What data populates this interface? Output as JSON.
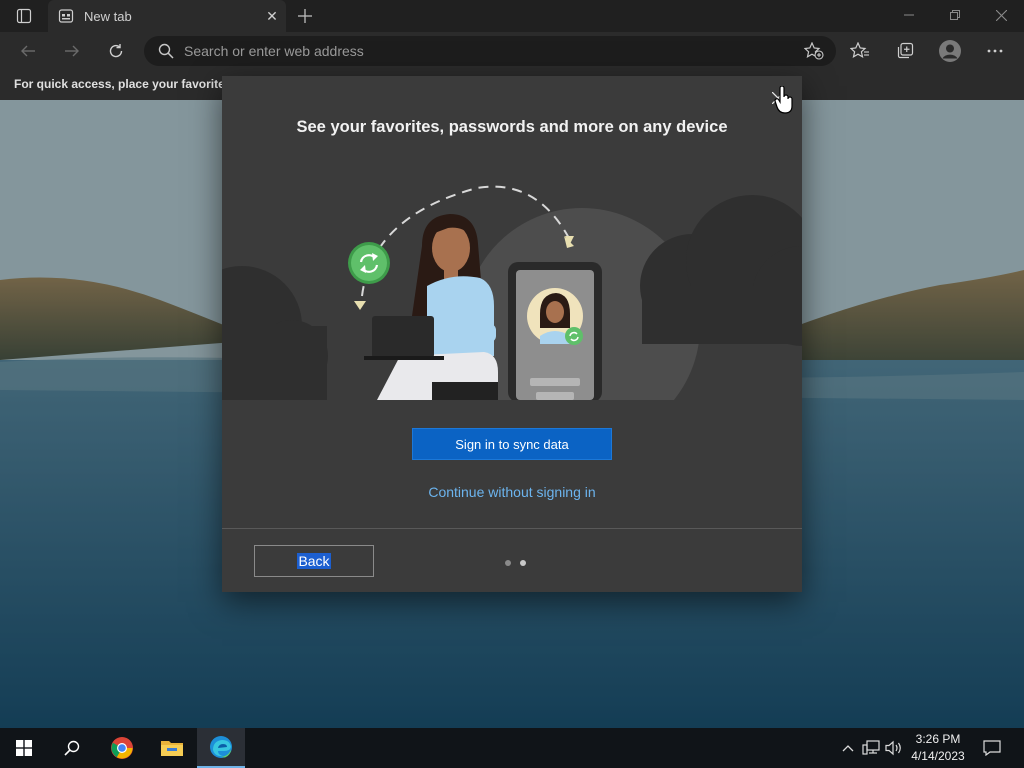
{
  "browser": {
    "tab": {
      "title": "New tab"
    },
    "address_bar": {
      "placeholder": "Search or enter web address"
    },
    "favorites_bar": {
      "text": "For quick access, place your favorites h"
    }
  },
  "dialog": {
    "title": "See your favorites, passwords and more on any device",
    "primary_button": "Sign in to sync data",
    "secondary_link": "Continue without signing in",
    "back_button": "Back",
    "pagination": {
      "total": 2,
      "current": 2
    }
  },
  "taskbar": {
    "items": [
      "start",
      "search",
      "chrome",
      "file-explorer",
      "edge"
    ],
    "clock": {
      "time": "3:26 PM",
      "date": "4/14/2023"
    }
  },
  "colors": {
    "accent": "#0b63c4",
    "link": "#6cb4ee",
    "dialog_bg": "#3b3b3b",
    "chrome_bg": "#2b2b2b"
  }
}
